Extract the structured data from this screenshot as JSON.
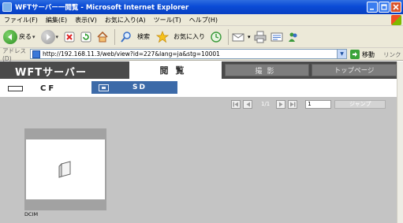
{
  "window": {
    "title": "WFTサーバー一閲覧 - Microsoft Internet Explorer"
  },
  "menubar": {
    "items": [
      "ファイル(F)",
      "編集(E)",
      "表示(V)",
      "お気に入り(A)",
      "ツール(T)",
      "ヘルプ(H)"
    ]
  },
  "toolbar": {
    "back_label": "戻る",
    "search_label": "検索",
    "favorites_label": "お気に入り"
  },
  "address": {
    "label": "アドレス(D)",
    "url": "http://192.168.11.3/web/view?id=227&lang=ja&stg=10001",
    "go_label": "移動",
    "links_label": "リンク"
  },
  "app": {
    "brand": "WFTサーバー",
    "nav": {
      "view": "閲覧",
      "shoot": "撮影",
      "top": "トップページ"
    },
    "cards": {
      "cf": "CF",
      "sd": "SD"
    },
    "pager": {
      "count": "1/1",
      "page_value": "1",
      "jump_label": "ジャンプ"
    },
    "folder": {
      "name": "DCIM"
    }
  },
  "colors": {
    "brand_bar": "#4a4a4a",
    "selected_card": "#3c6aa8",
    "page_bg": "#c4c4c4",
    "nav_inactive": "#7d7d7d"
  }
}
